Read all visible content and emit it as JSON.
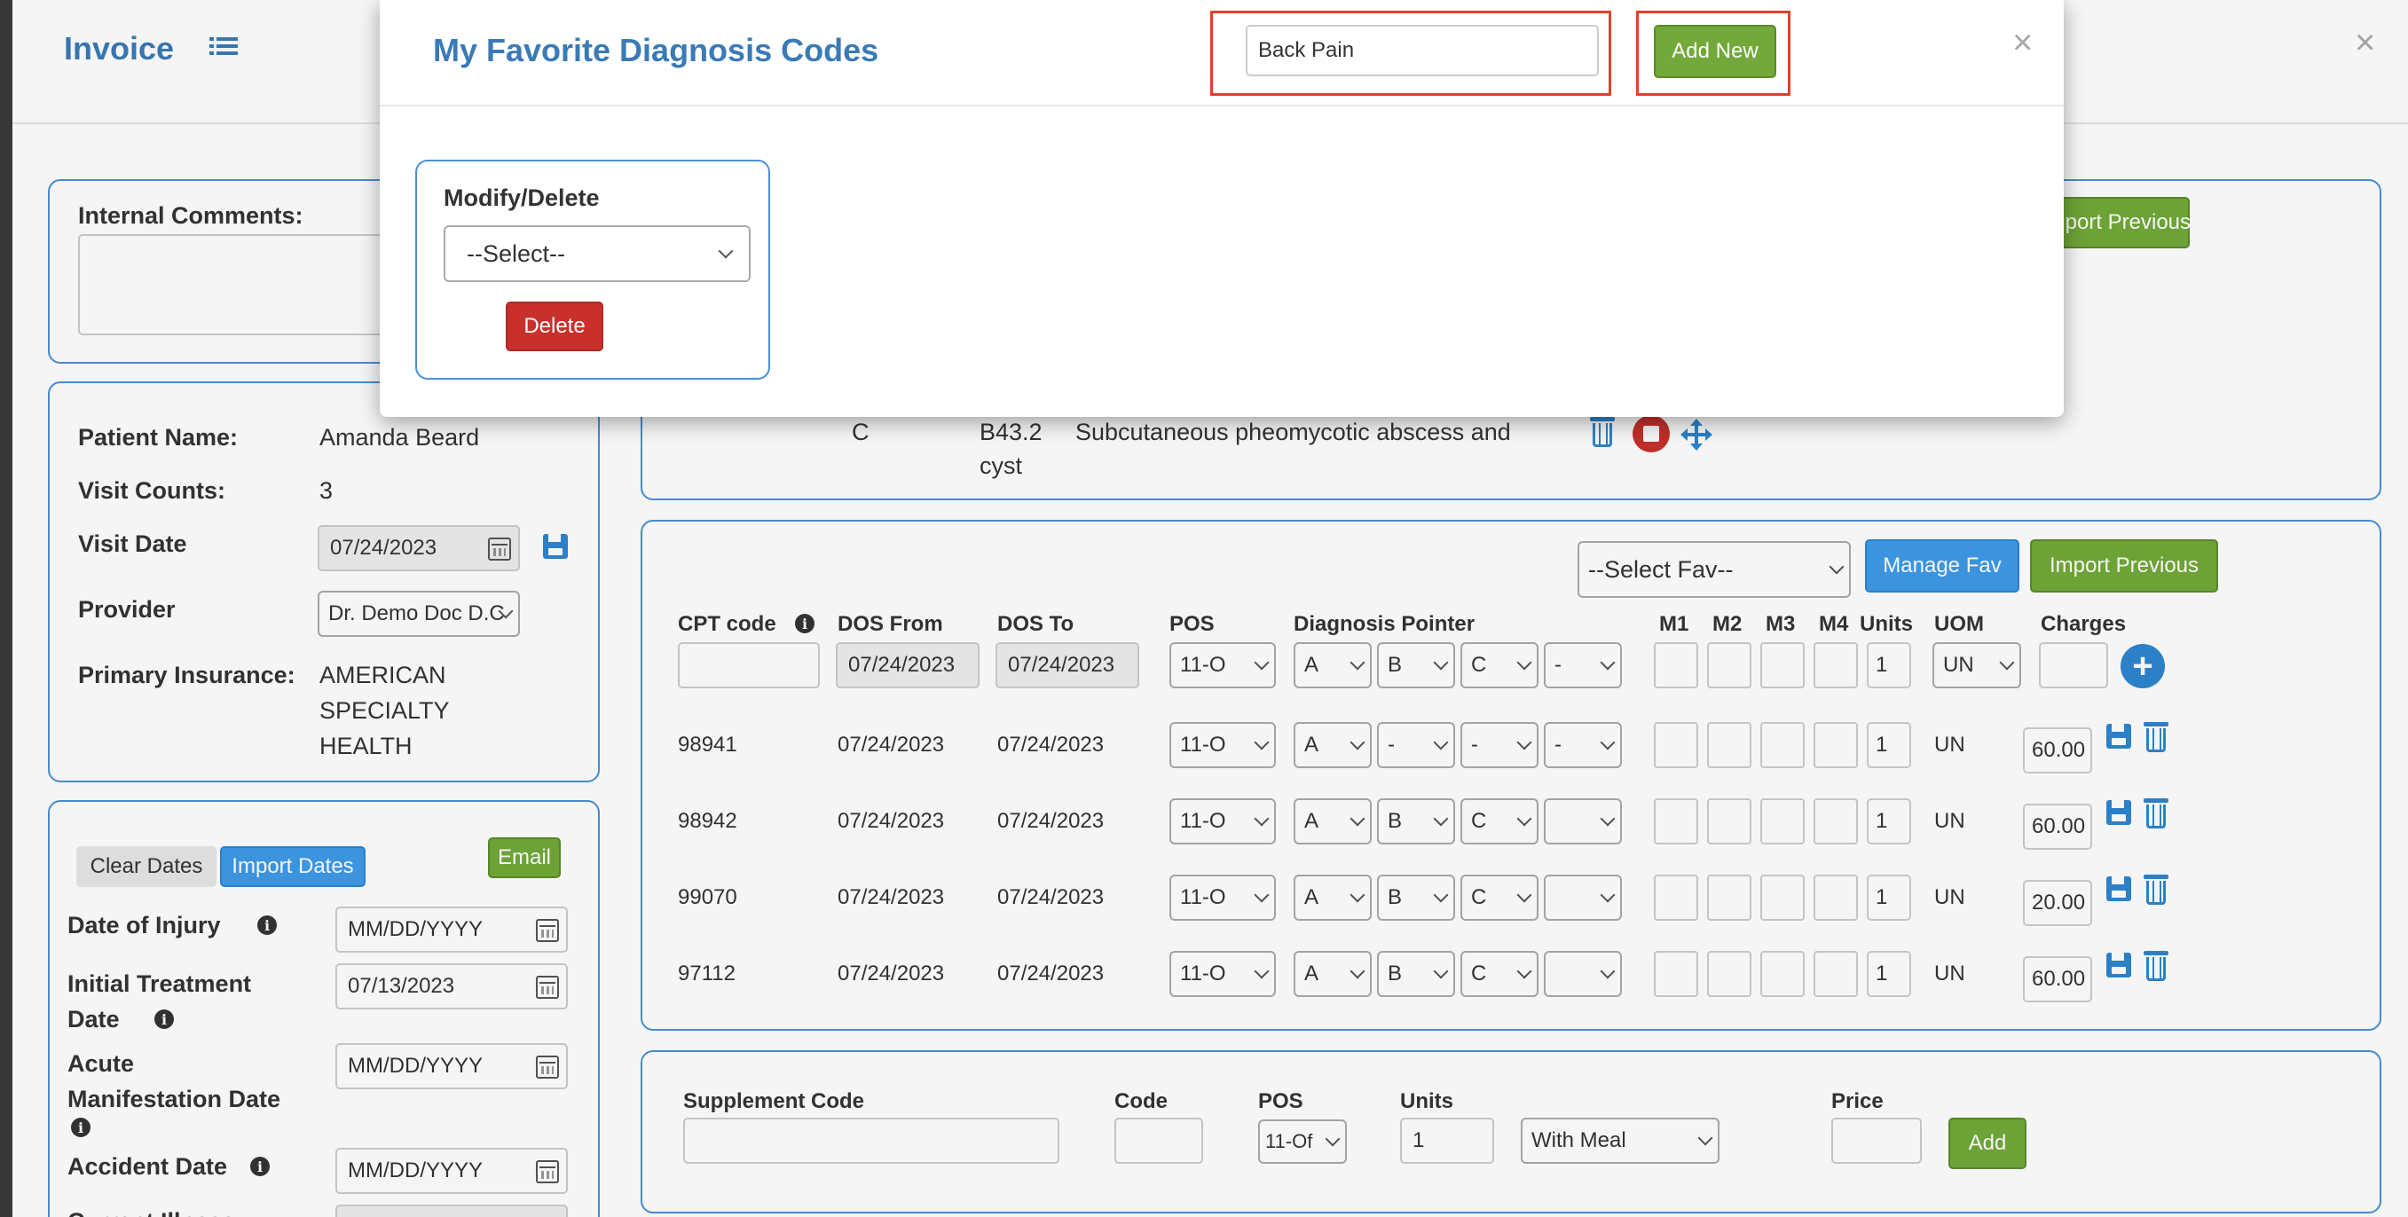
{
  "invoice": {
    "title": "Invoice",
    "close_glyph": "×"
  },
  "comments": {
    "label": "Internal Comments:",
    "import_previous": "Import Previous"
  },
  "patient": {
    "name_label": "Patient Name:",
    "name_value": "Amanda Beard",
    "visits_label": "Visit Counts:",
    "visits_value": "3",
    "visit_date_label": "Visit Date",
    "visit_date_value": "07/24/2023",
    "provider_label": "Provider",
    "provider_value": "Dr. Demo Doc D.C",
    "insurance_label": "Primary Insurance:",
    "insurance_line1": "AMERICAN",
    "insurance_line2": "SPECIALTY",
    "insurance_line3": "HEALTH"
  },
  "dates": {
    "clear": "Clear Dates",
    "import": "Import Dates",
    "email": "Email",
    "injury_label": "Date of Injury",
    "injury_value": "MM/DD/YYYY",
    "initial_label_1": "Initial Treatment",
    "initial_label_2": "Date",
    "initial_value": "07/13/2023",
    "acute_label_1": "Acute",
    "acute_label_2": "Manifestation Date",
    "acute_value": "MM/DD/YYYY",
    "accident_label": "Accident Date",
    "accident_value": "MM/DD/YYYY",
    "partial_label": "Current Illness"
  },
  "diagnosis": {
    "row_letter": "C",
    "row_code": "B43.2",
    "row_desc_1": "Subcutaneous pheomycotic abscess and",
    "row_desc_2": "cyst"
  },
  "cpt": {
    "select_fav": "--Select Fav--",
    "manage_fav": "Manage Fav",
    "import_previous": "Import Previous",
    "headers": {
      "cpt": "CPT code",
      "dos_from": "DOS From",
      "dos_to": "DOS To",
      "pos": "POS",
      "pointer": "Diagnosis Pointer",
      "m1": "M1",
      "m2": "M2",
      "m3": "M3",
      "m4": "M4",
      "units": "Units",
      "uom": "UOM",
      "charges": "Charges"
    },
    "new_row": {
      "dos_from": "07/24/2023",
      "dos_to": "07/24/2023",
      "pos": "11-O",
      "p1": "A",
      "p2": "B",
      "p3": "C",
      "p4": "-",
      "units": "1",
      "uom": "UN"
    },
    "rows": [
      {
        "code": "98941",
        "from": "07/24/2023",
        "to": "07/24/2023",
        "pos": "11-O",
        "p1": "A",
        "p2": "-",
        "p3": "-",
        "p4": "-",
        "units": "1",
        "uom": "UN",
        "charge": "60.00"
      },
      {
        "code": "98942",
        "from": "07/24/2023",
        "to": "07/24/2023",
        "pos": "11-O",
        "p1": "A",
        "p2": "B",
        "p3": "C",
        "p4": "",
        "units": "1",
        "uom": "UN",
        "charge": "60.00"
      },
      {
        "code": "99070",
        "from": "07/24/2023",
        "to": "07/24/2023",
        "pos": "11-O",
        "p1": "A",
        "p2": "B",
        "p3": "C",
        "p4": "",
        "units": "1",
        "uom": "UN",
        "charge": "20.00"
      },
      {
        "code": "97112",
        "from": "07/24/2023",
        "to": "07/24/2023",
        "pos": "11-O",
        "p1": "A",
        "p2": "B",
        "p3": "C",
        "p4": "",
        "units": "1",
        "uom": "UN",
        "charge": "60.00"
      }
    ]
  },
  "supplement": {
    "code_label": "Supplement Code",
    "code2_label": "Code",
    "pos_label": "POS",
    "pos_value": "11-Of",
    "units_label": "Units",
    "units_value": "1",
    "meal_value": "With Meal",
    "price_label": "Price",
    "add": "Add"
  },
  "modal": {
    "title": "My Favorite Diagnosis Codes",
    "search_value": "Back Pain",
    "add_new": "Add New",
    "close_glyph": "×",
    "modify_label": "Modify/Delete",
    "select_value": "--Select--",
    "delete": "Delete"
  },
  "colors": {
    "accent_blue": "#3f9be8",
    "success_green": "#72a93a",
    "danger_red": "#c9302c",
    "highlight": "#e0402a"
  }
}
